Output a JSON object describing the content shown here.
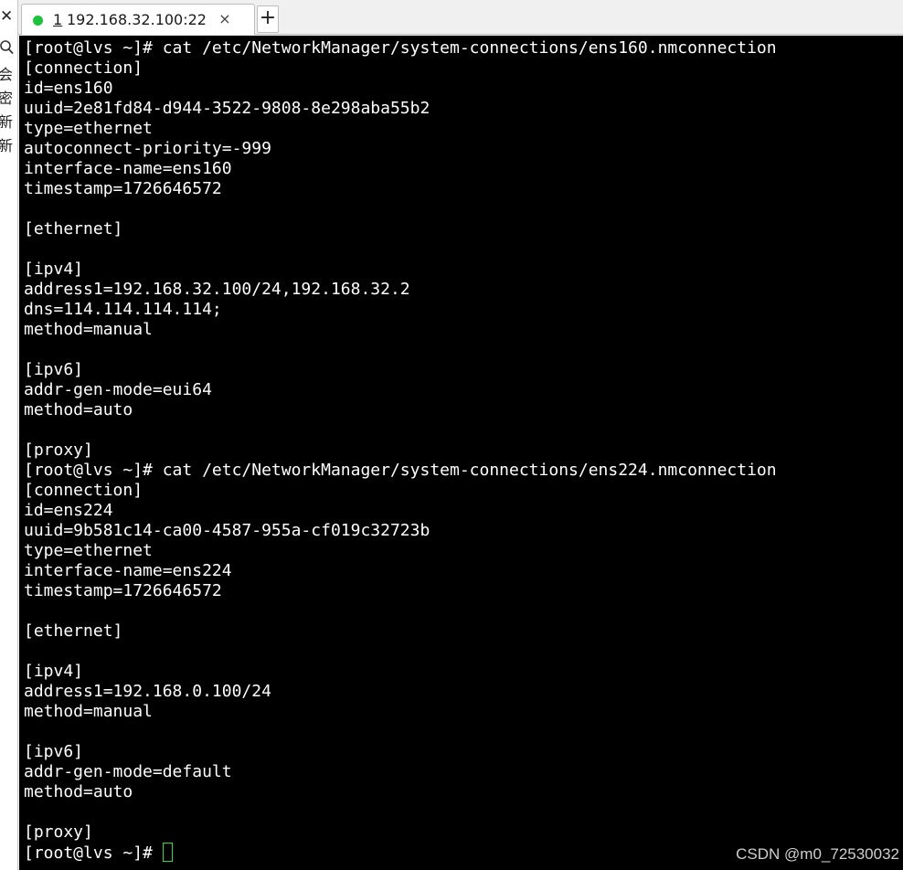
{
  "side_panel": {
    "close_icon": "close-icon",
    "search_icon": "search-icon",
    "fragments": [
      "会",
      "密",
      "新",
      "新"
    ]
  },
  "tabs": [
    {
      "number": "1",
      "title": " 192.168.32.100:22",
      "status_color": "#1ec13b",
      "close_label": "×"
    }
  ],
  "new_tab_label": "+",
  "terminal": {
    "lines": [
      "[root@lvs ~]# cat /etc/NetworkManager/system-connections/ens160.nmconnection",
      "[connection]",
      "id=ens160",
      "uuid=2e81fd84-d944-3522-9808-8e298aba55b2",
      "type=ethernet",
      "autoconnect-priority=-999",
      "interface-name=ens160",
      "timestamp=1726646572",
      "",
      "[ethernet]",
      "",
      "[ipv4]",
      "address1=192.168.32.100/24,192.168.32.2",
      "dns=114.114.114.114;",
      "method=manual",
      "",
      "[ipv6]",
      "addr-gen-mode=eui64",
      "method=auto",
      "",
      "[proxy]",
      "[root@lvs ~]# cat /etc/NetworkManager/system-connections/ens224.nmconnection",
      "[connection]",
      "id=ens224",
      "uuid=9b581c14-ca00-4587-955a-cf019c32723b",
      "type=ethernet",
      "interface-name=ens224",
      "timestamp=1726646572",
      "",
      "[ethernet]",
      "",
      "[ipv4]",
      "address1=192.168.0.100/24",
      "method=manual",
      "",
      "[ipv6]",
      "addr-gen-mode=default",
      "method=auto",
      "",
      "[proxy]"
    ],
    "prompt": "[root@lvs ~]# ",
    "cursor_color": "#2ee02e",
    "background": "#000000",
    "foreground": "#ffffff"
  },
  "watermark": "CSDN @m0_72530032"
}
